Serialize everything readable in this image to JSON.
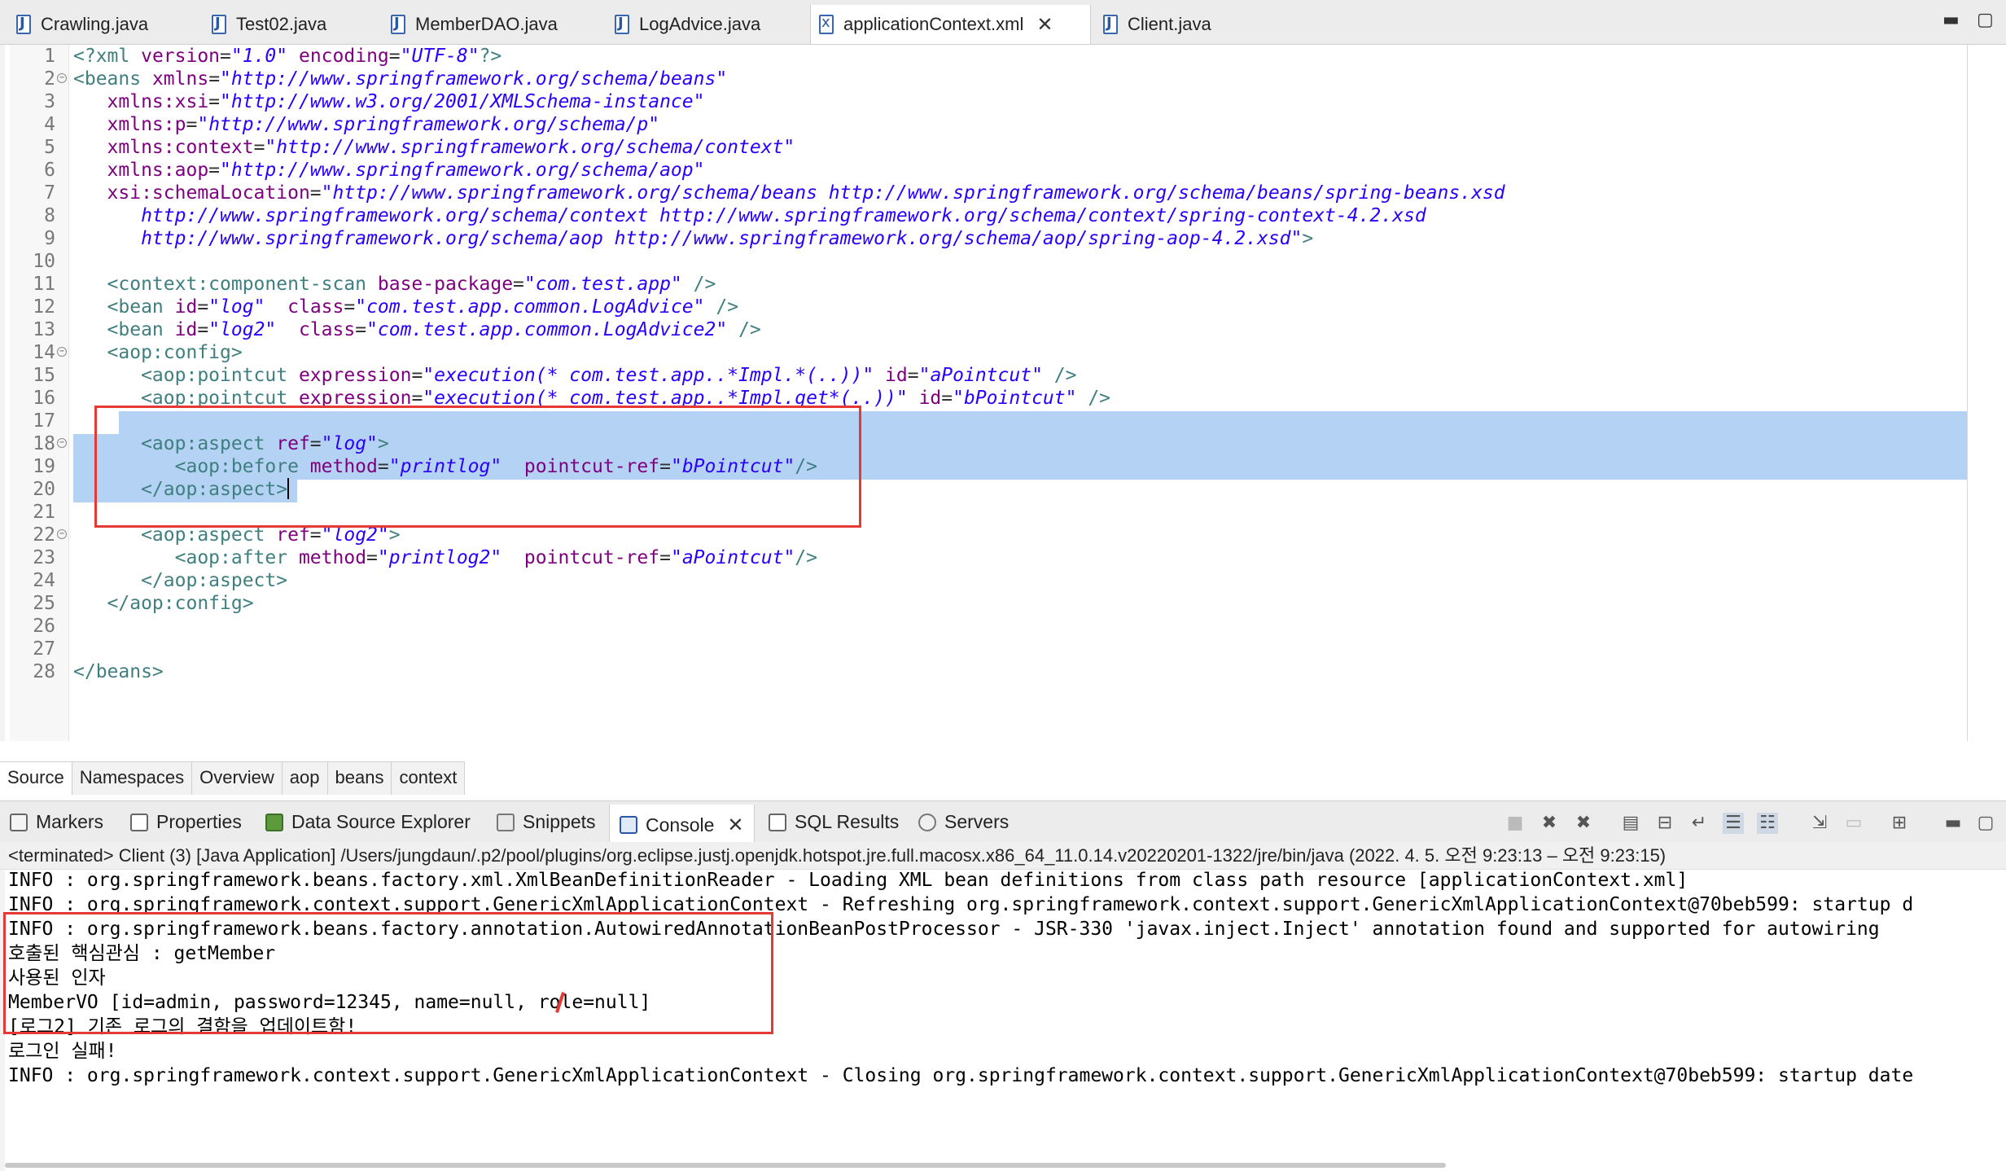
{
  "editor_tabs": [
    {
      "label": "Crawling.java",
      "icon": "java-file-icon"
    },
    {
      "label": "Test02.java",
      "icon": "java-file-icon"
    },
    {
      "label": "MemberDAO.java",
      "icon": "java-file-icon"
    },
    {
      "label": "LogAdvice.java",
      "icon": "java-file-icon"
    },
    {
      "label": "applicationContext.xml",
      "icon": "xml-file-icon",
      "active": true
    },
    {
      "label": "Client.java",
      "icon": "java-file-icon"
    }
  ],
  "code": {
    "l1": {
      "n": "1",
      "a": "<?xml ",
      "b": "version",
      "c": "=",
      "d": "\"1.0\"",
      "e": " encoding",
      "f": "=",
      "g": "\"UTF-8\"",
      "h": "?>"
    },
    "l2": {
      "n": "2",
      "a": "<beans ",
      "b": "xmlns",
      "c": "=",
      "d": "\"http://www.springframework.org/schema/beans\""
    },
    "l3": {
      "n": "3",
      "b": "   xmlns:xsi",
      "c": "=",
      "d": "\"http://www.w3.org/2001/XMLSchema-instance\""
    },
    "l4": {
      "n": "4",
      "b": "   xmlns:p",
      "c": "=",
      "d": "\"http://www.springframework.org/schema/p\""
    },
    "l5": {
      "n": "5",
      "b": "   xmlns:context",
      "c": "=",
      "d": "\"http://www.springframework.org/schema/context\""
    },
    "l6": {
      "n": "6",
      "b": "   xmlns:aop",
      "c": "=",
      "d": "\"http://www.springframework.org/schema/aop\""
    },
    "l7": {
      "n": "7",
      "b": "   xsi:schemaLocation",
      "c": "=",
      "d": "\"http://www.springframework.org/schema/beans http://www.springframework.org/schema/beans/spring-beans.xsd"
    },
    "l8": {
      "n": "8",
      "d": "      http://www.springframework.org/schema/context http://www.springframework.org/schema/context/spring-context-4.2.xsd"
    },
    "l9": {
      "n": "9",
      "d": "      http://www.springframework.org/schema/aop http://www.springframework.org/schema/aop/spring-aop-4.2.xsd\"",
      "h": ">"
    },
    "l10": {
      "n": "10"
    },
    "l11": {
      "n": "11",
      "a": "   <context:component-scan ",
      "b": "base-package",
      "c": "=",
      "d": "\"com.test.app\"",
      "h": " />"
    },
    "l12": {
      "n": "12",
      "a": "   <bean ",
      "b": "id",
      "c": "=",
      "d": "\"log\"",
      "e": "  class",
      "f": "=",
      "g": "\"com.test.app.common.LogAdvice\"",
      "h": " />"
    },
    "l13": {
      "n": "13",
      "a": "   <bean ",
      "b": "id",
      "c": "=",
      "d": "\"log2\"",
      "e": "  class",
      "f": "=",
      "g": "\"com.test.app.common.LogAdvice2\"",
      "h": " />"
    },
    "l14": {
      "n": "14",
      "a": "   <aop:config>"
    },
    "l15": {
      "n": "15",
      "a": "      <aop:pointcut ",
      "b": "expression",
      "c": "=",
      "d": "\"execution(* com.test.app..*Impl.*(..))\"",
      "e": " id",
      "f": "=",
      "g": "\"aPointcut\"",
      "h": " />"
    },
    "l16": {
      "n": "16",
      "a": "      <aop:pointcut ",
      "b": "expression",
      "c": "=",
      "d": "\"execution(* com.test.app..*Impl.get*(..))\"",
      "e": " id",
      "f": "=",
      "g": "\"bPointcut\"",
      "h": " />"
    },
    "l17": {
      "n": "17"
    },
    "l18": {
      "n": "18",
      "a": "      <aop:aspect ",
      "b": "ref",
      "c": "=",
      "d": "\"log\"",
      "h": ">"
    },
    "l19": {
      "n": "19",
      "a": "         <aop:before ",
      "b": "method",
      "c": "=",
      "d": "\"printlog\"",
      "e": "  pointcut-ref",
      "f": "=",
      "g": "\"bPointcut\"",
      "h": "/>"
    },
    "l20": {
      "n": "20",
      "a": "      </aop:aspect>"
    },
    "l21": {
      "n": "21"
    },
    "l22": {
      "n": "22",
      "a": "      <aop:aspect ",
      "b": "ref",
      "c": "=",
      "d": "\"log2\"",
      "h": ">"
    },
    "l23": {
      "n": "23",
      "a": "         <aop:after ",
      "b": "method",
      "c": "=",
      "d": "\"printlog2\"",
      "e": "  pointcut-ref",
      "f": "=",
      "g": "\"aPointcut\"",
      "h": "/>"
    },
    "l24": {
      "n": "24",
      "a": "      </aop:aspect>"
    },
    "l25": {
      "n": "25",
      "a": "   </aop:config>"
    },
    "l26": {
      "n": "26"
    },
    "l27": {
      "n": "27"
    },
    "l28": {
      "n": "28",
      "a": "</beans>"
    }
  },
  "sub_tabs": [
    "Source",
    "Namespaces",
    "Overview",
    "aop",
    "beans",
    "context"
  ],
  "view_tabs": [
    {
      "label": "Markers",
      "icon": "markers-icon"
    },
    {
      "label": "Properties",
      "icon": "properties-icon"
    },
    {
      "label": "Data Source Explorer",
      "icon": "data-source-icon"
    },
    {
      "label": "Snippets",
      "icon": "snippets-icon"
    },
    {
      "label": "Console",
      "icon": "console-icon",
      "active": true
    },
    {
      "label": "SQL Results",
      "icon": "sql-results-icon"
    },
    {
      "label": "Servers",
      "icon": "servers-icon"
    }
  ],
  "console": {
    "status": "<terminated> Client (3) [Java Application] /Users/jungdaun/.p2/pool/plugins/org.eclipse.justj.openjdk.hotspot.jre.full.macosx.x86_64_11.0.14.v20220201-1322/jre/bin/java  (2022. 4. 5. 오전 9:23:13 – 오전 9:23:15)",
    "lines": [
      "INFO : org.springframework.beans.factory.xml.XmlBeanDefinitionReader - Loading XML bean definitions from class path resource [applicationContext.xml]",
      "INFO : org.springframework.context.support.GenericXmlApplicationContext - Refreshing org.springframework.context.support.GenericXmlApplicationContext@70beb599: startup d",
      "INFO : org.springframework.beans.factory.annotation.AutowiredAnnotationBeanPostProcessor - JSR-330 'javax.inject.Inject' annotation found and supported for autowiring",
      "호출된 핵심관심 : getMember",
      "사용된 인자",
      "MemberVO [id=admin, password=12345, name=null, role=null]",
      "[로그2] 기존 로그의 결함을 업데이트함!",
      "로그인 실패!",
      "INFO : org.springframework.context.support.GenericXmlApplicationContext - Closing org.springframework.context.support.GenericXmlApplicationContext@70beb599: startup date"
    ]
  }
}
